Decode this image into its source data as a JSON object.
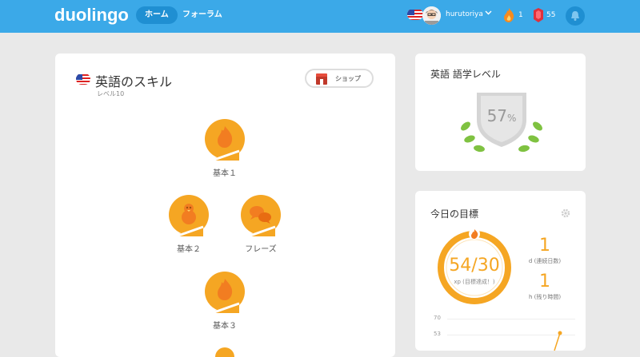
{
  "header": {
    "logo": "duolingo",
    "nav": {
      "home": "ホーム",
      "forum": "フォーラム"
    },
    "username": "hurutoriya",
    "streak": "1",
    "gems": "55",
    "colors": {
      "bar": "#3ba9e8",
      "active": "#1f8fd2"
    }
  },
  "skills": {
    "title": "英語のスキル",
    "level": "レベル10",
    "shop_label": "ショップ",
    "items": [
      {
        "label": "基本１",
        "icon": "flame-egg-icon"
      },
      {
        "label": "基本２",
        "icon": "chick-icon"
      },
      {
        "label": "フレーズ",
        "icon": "speech-bubbles-icon"
      },
      {
        "label": "基本３",
        "icon": "flame-egg-icon"
      }
    ]
  },
  "language_level": {
    "title": "英語 語学レベル",
    "percent": "57",
    "percent_sign": "%"
  },
  "daily_goal": {
    "title": "今日の目標",
    "xp_value": "54/30",
    "xp_label": "xp (目標達成！)",
    "streak_days": "1",
    "streak_label": "d (連続日数)",
    "hours_left": "1",
    "hours_label": "h (残り時間)",
    "chart": {
      "ticks": [
        "70",
        "53"
      ]
    }
  }
}
